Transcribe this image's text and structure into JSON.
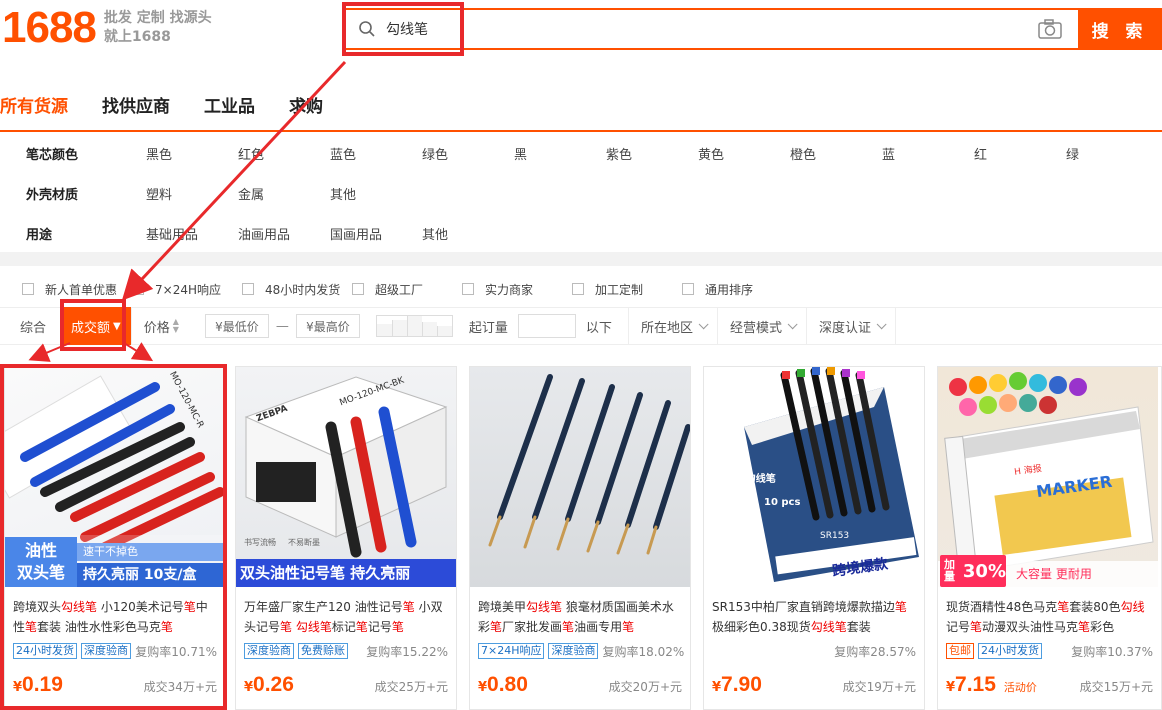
{
  "header": {
    "logo_number": "1688",
    "slogan_line1": "批发 定制 找源头",
    "slogan_line2": "就上1688",
    "search_value": "勾线笔",
    "search_button": "搜 索"
  },
  "nav": [
    "所有货源",
    "找供应商",
    "工业品",
    "求购"
  ],
  "attributes": [
    {
      "key": "笔芯颜色",
      "values": [
        "黑色",
        "红色",
        "蓝色",
        "绿色",
        "黑",
        "紫色",
        "黄色",
        "橙色",
        "蓝",
        "红",
        "绿"
      ]
    },
    {
      "key": "外壳材质",
      "values": [
        "塑料",
        "金属",
        "其他"
      ]
    },
    {
      "key": "用途",
      "values": [
        "基础用品",
        "油画用品",
        "国画用品",
        "其他"
      ]
    }
  ],
  "checkboxes": [
    "新人首单优惠",
    "7×24H响应",
    "48小时内发货",
    "超级工厂",
    "实力商家",
    "加工定制",
    "通用排序"
  ],
  "sort": {
    "comprehensive": "综合",
    "sales": "成交额",
    "price": "价格",
    "min_price": "¥最低价",
    "dash": "—",
    "max_price": "¥最高价",
    "moq_label": "起订量",
    "below": "以下",
    "location": "所在地区",
    "mode": "经营模式",
    "verify": "深度认证"
  },
  "colors": {
    "brand": "#ff5000",
    "annotation": "#e8292b",
    "tag_blue": "#1a6fc4"
  },
  "products": [
    {
      "title_parts": [
        [
          "跨境双头",
          false
        ],
        [
          "勾线笔",
          true
        ],
        [
          " 小120美术记号",
          false
        ],
        [
          "笔",
          true
        ],
        [
          "中性",
          false
        ],
        [
          "笔",
          true
        ],
        [
          "套装 油性水性彩色马克",
          false
        ],
        [
          "笔",
          true
        ]
      ],
      "tags": [
        {
          "text": "24小时发货",
          "red": false
        },
        {
          "text": "深度验商",
          "red": false
        }
      ],
      "repurchase": "复购率10.71%",
      "yen": "¥",
      "price": "0.19",
      "promo": "",
      "sold": "成交34万+元",
      "img_label1": "油性",
      "img_label2": "双头笔",
      "img_sub": "速干不掉色",
      "img_banner": "持久亮丽 10支/盒",
      "img_box_text": "MO-120-MC-R"
    },
    {
      "title_parts": [
        [
          "万年盛厂家生产120 油性记号",
          false
        ],
        [
          "笔",
          true
        ],
        [
          " 小双头记号",
          false
        ],
        [
          "笔",
          true
        ],
        [
          " ",
          false
        ],
        [
          "勾线笔",
          true
        ],
        [
          "标记",
          false
        ],
        [
          "笔",
          true
        ],
        [
          "记号",
          false
        ],
        [
          "笔",
          true
        ]
      ],
      "tags": [
        {
          "text": "深度验商",
          "red": false
        },
        {
          "text": "免费赊账",
          "red": false
        }
      ],
      "repurchase": "复购率15.22%",
      "yen": "¥",
      "price": "0.26",
      "promo": "",
      "sold": "成交25万+元",
      "img_banner": "双头油性记号笔 持久亮丽",
      "img_brand": "ZEBPA",
      "img_box_text": "MO-120-MC-BK",
      "img_icon1": "书写流畅",
      "img_icon2": "不易断墨"
    },
    {
      "title_parts": [
        [
          "跨境美甲",
          false
        ],
        [
          "勾线笔",
          true
        ],
        [
          " 狼毫材质国画美术水彩",
          false
        ],
        [
          "笔",
          true
        ],
        [
          "厂家批发画",
          false
        ],
        [
          "笔",
          true
        ],
        [
          "油画专用",
          false
        ],
        [
          "笔",
          true
        ]
      ],
      "tags": [
        {
          "text": "7×24H响应",
          "red": false
        },
        {
          "text": "深度验商",
          "red": false
        }
      ],
      "repurchase": "复购率18.02%",
      "yen": "¥",
      "price": "0.80",
      "promo": "",
      "sold": "成交20万+元"
    },
    {
      "title_parts": [
        [
          "SR153中柏厂家直销跨境爆款描边",
          false
        ],
        [
          "笔",
          true
        ],
        [
          " 极细彩色0.38现货",
          false
        ],
        [
          "勾线笔",
          true
        ],
        [
          "套装",
          false
        ]
      ],
      "tags": [],
      "repurchase": "复购率28.57%",
      "yen": "¥",
      "price": "7.90",
      "promo": "",
      "sold": "成交19万+元",
      "img_line1": "授权代理",
      "img_line2": "SR153勾线笔",
      "img_pcs": "10 pcs",
      "img_model": "SR153",
      "img_cross": "跨境爆款"
    },
    {
      "title_parts": [
        [
          "现货酒精性48色马克",
          false
        ],
        [
          "笔",
          true
        ],
        [
          "套装80色",
          false
        ],
        [
          "勾线",
          true
        ],
        [
          "记号",
          false
        ],
        [
          "笔",
          true
        ],
        [
          "动漫双头油性马克",
          false
        ],
        [
          "笔",
          true
        ],
        [
          "彩色",
          false
        ]
      ],
      "tags": [
        {
          "text": "包邮",
          "red": true
        },
        {
          "text": "24小时发货",
          "red": false
        }
      ],
      "repurchase": "复购率10.37%",
      "yen": "¥",
      "price": "7.15",
      "promo": "活动价",
      "sold": "成交15万+元",
      "img_marker": "MARKER",
      "img_h": "H 海报",
      "img_add": "加量",
      "img_pct": "30%",
      "img_cap": "大容量 更耐用"
    }
  ]
}
